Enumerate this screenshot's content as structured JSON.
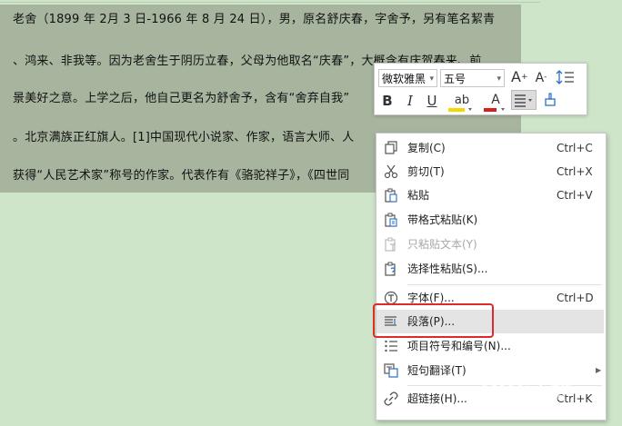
{
  "document": {
    "lines": [
      "老舍（1899 年 2月 3 日-1966 年 8 月 24 日），男，原名舒庆春，字舍予，另有笔名絜青",
      "、鸿来、非我等。因为老舍生于阴历立春，父母为他取名“庆春”，大概含有庆贺春来、前",
      "景美好之意。上学之后，他自己更名为舒舍予，含有“舍弃自我”",
      "。北京满族正红旗人。[1]中国现代小说家、作家，语言大师、人",
      "获得“人民艺术家”称号的作家。代表作有《骆驼祥子》，《四世同"
    ]
  },
  "mini_toolbar": {
    "font_name": "微软雅黑",
    "font_size": "五号",
    "grow_font": "A",
    "shrink_font": "A",
    "bold": "B",
    "italic": "I",
    "underline": "U",
    "highlight": "ab",
    "font_color": "A",
    "highlight_color": "#f5d800",
    "font_color_value": "#d62020"
  },
  "context_menu": {
    "items": [
      {
        "label": "复制(C)",
        "shortcut": "Ctrl+C",
        "icon": "copy-icon"
      },
      {
        "label": "剪切(T)",
        "shortcut": "Ctrl+X",
        "icon": "scissors-icon"
      },
      {
        "label": "粘贴",
        "shortcut": "Ctrl+V",
        "icon": "paste-icon"
      },
      {
        "label": "带格式粘贴(K)",
        "shortcut": "",
        "icon": "paste-format-icon"
      },
      {
        "label": "只粘贴文本(Y)",
        "shortcut": "",
        "icon": "paste-text-icon"
      },
      {
        "label": "选择性粘贴(S)...",
        "shortcut": "",
        "icon": "paste-special-icon"
      },
      {
        "label": "字体(F)...",
        "shortcut": "Ctrl+D",
        "icon": "font-icon"
      },
      {
        "label": "段落(P)...",
        "shortcut": "",
        "icon": "paragraph-icon"
      },
      {
        "label": "项目符号和编号(N)...",
        "shortcut": "",
        "icon": "bullets-icon"
      },
      {
        "label": "短句翻译(T)",
        "shortcut": "",
        "icon": "translate-icon"
      },
      {
        "label": "超链接(H)...",
        "shortcut": "Ctrl+K",
        "icon": "link-icon"
      }
    ]
  },
  "watermark": {
    "text": "Bai经验",
    "sub": "jingyan.baidu.com"
  }
}
